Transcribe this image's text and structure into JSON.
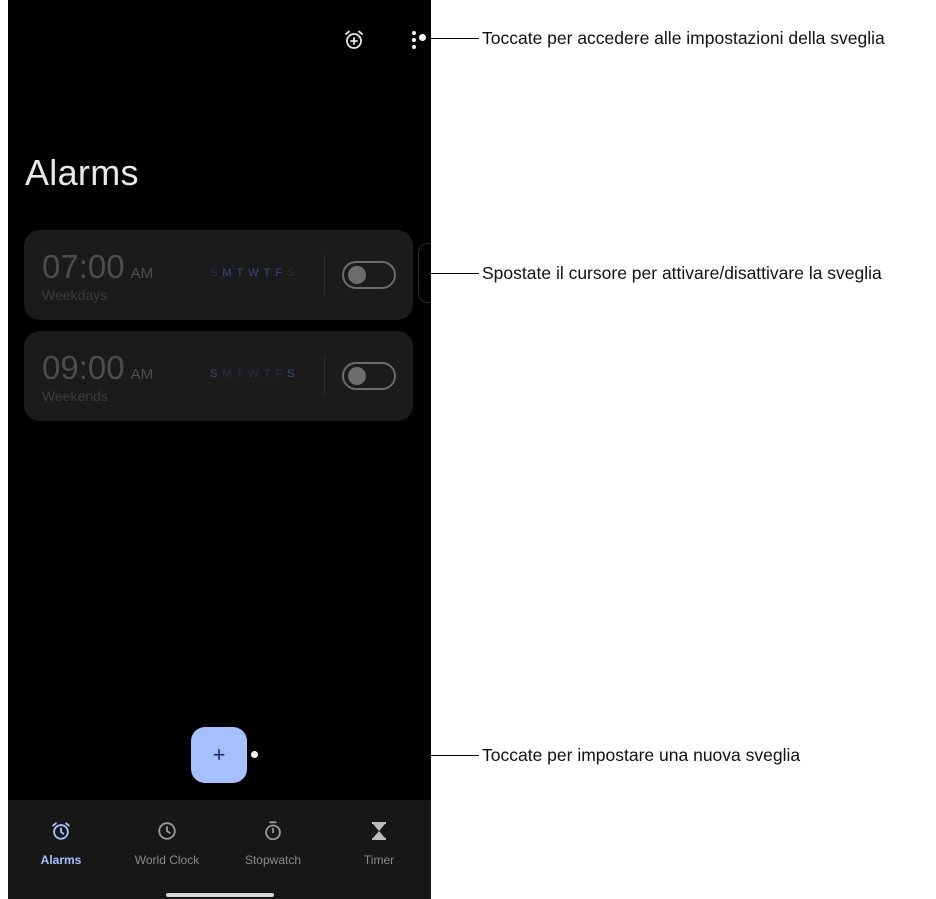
{
  "header": {
    "title": "Alarms",
    "add_icon": "alarm-add-icon",
    "menu_icon": "more-vertical-icon"
  },
  "alarms": [
    {
      "time": "07:00",
      "ampm": "AM",
      "repeat": "Weekdays",
      "days": [
        {
          "letter": "S",
          "active": false
        },
        {
          "letter": "M",
          "active": true
        },
        {
          "letter": "T",
          "active": true
        },
        {
          "letter": "W",
          "active": true
        },
        {
          "letter": "T",
          "active": true
        },
        {
          "letter": "F",
          "active": true
        },
        {
          "letter": "S",
          "active": false
        }
      ],
      "enabled": false
    },
    {
      "time": "09:00",
      "ampm": "AM",
      "repeat": "Weekends",
      "days": [
        {
          "letter": "S",
          "active": true
        },
        {
          "letter": "M",
          "active": false
        },
        {
          "letter": "T",
          "active": false
        },
        {
          "letter": "W",
          "active": false
        },
        {
          "letter": "T",
          "active": false
        },
        {
          "letter": "F",
          "active": false
        },
        {
          "letter": "S",
          "active": true
        }
      ],
      "enabled": false
    }
  ],
  "fab": {
    "label": "+",
    "icon": "plus-icon"
  },
  "bottom_nav": [
    {
      "label": "Alarms",
      "icon": "alarm-icon",
      "active": true
    },
    {
      "label": "World Clock",
      "icon": "clock-icon",
      "active": false
    },
    {
      "label": "Stopwatch",
      "icon": "stopwatch-icon",
      "active": false
    },
    {
      "label": "Timer",
      "icon": "hourglass-icon",
      "active": false
    }
  ],
  "callouts": {
    "settings": "Toccate per accedere alle impostazioni della sveglia",
    "toggle": "Spostate il cursore per attivare/disattivare la sveglia",
    "new_alarm": "Toccate per impostare una nuova sveglia"
  },
  "colors": {
    "background": "#000000",
    "card": "#1b1b1b",
    "accent": "#a6c0ff",
    "day_active": "#3b4c80",
    "day_inactive": "#2b2f3d"
  }
}
